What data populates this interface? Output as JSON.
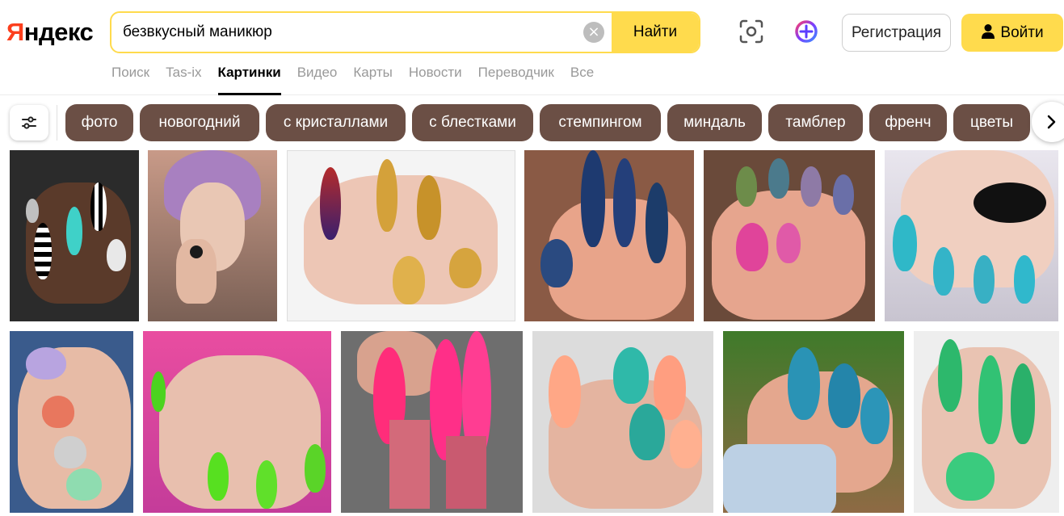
{
  "logo": {
    "first": "Я",
    "rest": "ндекс"
  },
  "search": {
    "query": "безвкусный маникюр",
    "button_label": "Найти"
  },
  "header": {
    "register_label": "Регистрация",
    "login_label": "Войти"
  },
  "tabs": [
    {
      "label": "Поиск"
    },
    {
      "label": "Tas-ix"
    },
    {
      "label": "Картинки",
      "active": true
    },
    {
      "label": "Видео"
    },
    {
      "label": "Карты"
    },
    {
      "label": "Новости"
    },
    {
      "label": "Переводчик"
    },
    {
      "label": "Все"
    }
  ],
  "chips": [
    {
      "label": "фото"
    },
    {
      "label": "новогодний"
    },
    {
      "label": "с кристаллами"
    },
    {
      "label": "с блестками"
    },
    {
      "label": "стемпингом"
    },
    {
      "label": "миндаль"
    },
    {
      "label": "тамблер"
    },
    {
      "label": "френч"
    },
    {
      "label": "цветы"
    }
  ],
  "colors": {
    "accent": "#ffdb4d",
    "logo_red": "#fc3f1d",
    "chip_bg": "#6b4f45"
  }
}
